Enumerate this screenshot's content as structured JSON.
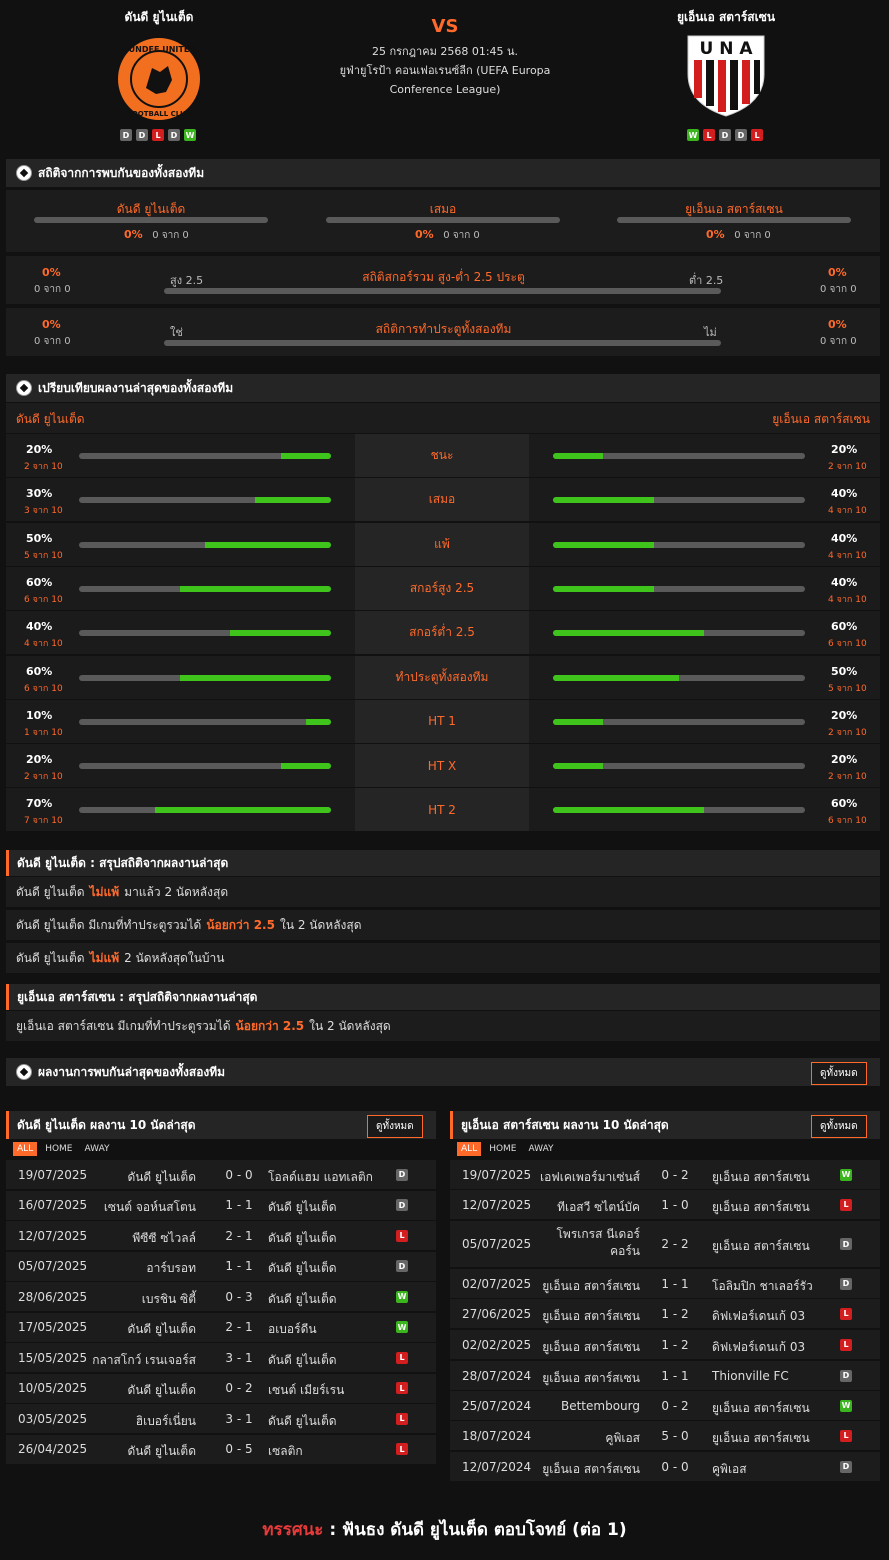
{
  "header": {
    "home_name": "ดันดี ยูไนเต็ด",
    "away_name": "ยูเอ็นเอ สตาร์สเซน",
    "vs": "VS",
    "date": "25 กรกฎาคม 2568 01:45 น.",
    "league_line1": "ยูฟ่ายูโรป้า คอนเฟอเรนซ์ลีก (UEFA Europa",
    "league_line2": "Conference League)",
    "home_logo_text": "DUNDEE UNITED FOOTBALL CLUB",
    "away_logo_text": "UNA",
    "home_form": [
      "D",
      "D",
      "L",
      "D",
      "W"
    ],
    "away_form": [
      "W",
      "L",
      "D",
      "D",
      "L"
    ]
  },
  "h2h": {
    "title": "สถิติจากการพบกันของทั้งสองทีม",
    "cols": [
      {
        "label": "ดันดี ยูไนเต็ด",
        "pct": "0%",
        "sub": "0 จาก 0"
      },
      {
        "label": "เสมอ",
        "pct": "0%",
        "sub": "0 จาก 0"
      },
      {
        "label": "ยูเอ็นเอ สตาร์สเซน",
        "pct": "0%",
        "sub": "0 จาก 0"
      }
    ],
    "ou": {
      "title": "สถิติสกอร์รวม สูง-ต่ำ 2.5 ประตู",
      "left_label": "สูง 2.5",
      "right_label": "ต่ำ 2.5",
      "left_pct": "0%",
      "left_sub": "0 จาก 0",
      "right_pct": "0%",
      "right_sub": "0 จาก 0"
    },
    "btts": {
      "title": "สถิติการทำประตูทั้งสองทีม",
      "left_label": "ใช่",
      "right_label": "ไม่",
      "left_pct": "0%",
      "left_sub": "0 จาก 0",
      "right_pct": "0%",
      "right_sub": "0 จาก 0"
    }
  },
  "compare": {
    "title": "เปรียบเทียบผลงานล่าสุดของทั้งสองทีม",
    "home_label": "ดันดี ยูไนเต็ด",
    "away_label": "ยูเอ็นเอ สตาร์สเซน",
    "rows": [
      {
        "label": "ชนะ",
        "hp": "20%",
        "hs": "2 จาก 10",
        "hv": 0.2,
        "ap": "20%",
        "as": "2 จาก 10",
        "av": 0.2
      },
      {
        "label": "เสมอ",
        "hp": "30%",
        "hs": "3 จาก 10",
        "hv": 0.3,
        "ap": "40%",
        "as": "4 จาก 10",
        "av": 0.4
      },
      {
        "label": "แพ้",
        "hp": "50%",
        "hs": "5 จาก 10",
        "hv": 0.5,
        "ap": "40%",
        "as": "4 จาก 10",
        "av": 0.4
      },
      {
        "label": "สกอร์สูง 2.5",
        "hp": "60%",
        "hs": "6 จาก 10",
        "hv": 0.6,
        "ap": "40%",
        "as": "4 จาก 10",
        "av": 0.4
      },
      {
        "label": "สกอร์ต่ำ 2.5",
        "hp": "40%",
        "hs": "4 จาก 10",
        "hv": 0.4,
        "ap": "60%",
        "as": "6 จาก 10",
        "av": 0.6
      },
      {
        "label": "ทำประตูทั้งสองทีม",
        "hp": "60%",
        "hs": "6 จาก 10",
        "hv": 0.6,
        "ap": "50%",
        "as": "5 จาก 10",
        "av": 0.5
      },
      {
        "label": "HT 1",
        "hp": "10%",
        "hs": "1 จาก 10",
        "hv": 0.1,
        "ap": "20%",
        "as": "2 จาก 10",
        "av": 0.2
      },
      {
        "label": "HT X",
        "hp": "20%",
        "hs": "2 จาก 10",
        "hv": 0.2,
        "ap": "20%",
        "as": "2 จาก 10",
        "av": 0.2
      },
      {
        "label": "HT 2",
        "hp": "70%",
        "hs": "7 จาก 10",
        "hv": 0.7,
        "ap": "60%",
        "as": "6 จาก 10",
        "av": 0.6
      }
    ]
  },
  "summary_home": {
    "title": "ดันดี ยูไนเต็ด : สรุปสถิติจากผลงานล่าสุด",
    "lines": [
      [
        "ดันดี ยูไนเต็ด",
        "ไม่แพ้",
        "มาแล้ว 2 นัดหลังสุด"
      ],
      [
        "ดันดี ยูไนเต็ด มีเกมที่ทำประตูรวมได้",
        "น้อยกว่า 2.5",
        "ใน 2 นัดหลังสุด"
      ],
      [
        "ดันดี ยูไนเต็ด",
        "ไม่แพ้",
        "2 นัดหลังสุดในบ้าน"
      ]
    ]
  },
  "summary_away": {
    "title": "ยูเอ็นเอ สตาร์สเซน : สรุปสถิติจากผลงานล่าสุด",
    "lines": [
      [
        "ยูเอ็นเอ สตาร์สเซน มีเกมที่ทำประตูรวมได้",
        "น้อยกว่า 2.5",
        "ใน 2 นัดหลังสุด"
      ]
    ]
  },
  "recent": {
    "title": "ผลงานการพบกันล่าสุดของทั้งสองทีม",
    "view_all": "ดูทั้งหมด"
  },
  "home_table": {
    "title": "ดันดี ยูไนเต็ด ผลงาน 10 นัดล่าสุด",
    "view_all": "ดูทั้งหมด",
    "tabs": [
      "ALL",
      "HOME",
      "AWAY"
    ],
    "rows": [
      {
        "date": "19/07/2025",
        "home": "ดันดี ยูไนเต็ด",
        "score": "0 - 0",
        "away": "โอลด์แฮม แอทเลติก",
        "res": "D"
      },
      {
        "date": "16/07/2025",
        "home": "เซนต์ จอห์นสโตน",
        "score": "1 - 1",
        "away": "ดันดี ยูไนเต็ด",
        "res": "D"
      },
      {
        "date": "12/07/2025",
        "home": "พีซีซี ซไวลล์",
        "score": "2 - 1",
        "away": "ดันดี ยูไนเต็ด",
        "res": "L"
      },
      {
        "date": "05/07/2025",
        "home": "อาร์บรอท",
        "score": "1 - 1",
        "away": "ดันดี ยูไนเต็ด",
        "res": "D"
      },
      {
        "date": "28/06/2025",
        "home": "เบรชิน ซิตี้",
        "score": "0 - 3",
        "away": "ดันดี ยูไนเต็ด",
        "res": "W"
      },
      {
        "date": "17/05/2025",
        "home": "ดันดี ยูไนเต็ด",
        "score": "2 - 1",
        "away": "อเบอร์ดีน",
        "res": "W"
      },
      {
        "date": "15/05/2025",
        "home": "กลาสโกว์ เรนเจอร์ส",
        "score": "3 - 1",
        "away": "ดันดี ยูไนเต็ด",
        "res": "L"
      },
      {
        "date": "10/05/2025",
        "home": "ดันดี ยูไนเต็ด",
        "score": "0 - 2",
        "away": "เซนต์ เมียร์เรน",
        "res": "L"
      },
      {
        "date": "03/05/2025",
        "home": "ฮิเบอร์เนี่ยน",
        "score": "3 - 1",
        "away": "ดันดี ยูไนเต็ด",
        "res": "L"
      },
      {
        "date": "26/04/2025",
        "home": "ดันดี ยูไนเต็ด",
        "score": "0 - 5",
        "away": "เซลติก",
        "res": "L"
      }
    ]
  },
  "away_table": {
    "title": "ยูเอ็นเอ สตาร์สเซน ผลงาน 10 นัดล่าสุด",
    "view_all": "ดูทั้งหมด",
    "tabs": [
      "ALL",
      "HOME",
      "AWAY"
    ],
    "rows": [
      {
        "date": "19/07/2025",
        "home": "เอฟเคเพอร์มาเซ่นส์",
        "home2": "",
        "score": "0 - 2",
        "away": "ยูเอ็นเอ สตาร์สเซน",
        "res": "W"
      },
      {
        "date": "12/07/2025",
        "home": "ทีเอสวี ซไตน์บัค",
        "home2": "",
        "score": "1 - 0",
        "away": "ยูเอ็นเอ สตาร์สเซน",
        "res": "L"
      },
      {
        "date": "05/07/2025",
        "home": "โพรเกรส นีเดอร์",
        "home2": "คอร์น",
        "score": "2 - 2",
        "away": "ยูเอ็นเอ สตาร์สเซน",
        "res": "D"
      },
      {
        "date": "02/07/2025",
        "home": "ยูเอ็นเอ สตาร์สเซน",
        "home2": "",
        "score": "1 - 1",
        "away": "โอลิมปิก ชาเลอร์รัว",
        "res": "D"
      },
      {
        "date": "27/06/2025",
        "home": "ยูเอ็นเอ สตาร์สเซน",
        "home2": "",
        "score": "1 - 2",
        "away": "ดิฟเฟอร์เดนเก้ 03",
        "res": "L"
      },
      {
        "date": "02/02/2025",
        "home": "ยูเอ็นเอ สตาร์สเซน",
        "home2": "",
        "score": "1 - 2",
        "away": "ดิฟเฟอร์เดนเก้ 03",
        "res": "L"
      },
      {
        "date": "28/07/2024",
        "home": "ยูเอ็นเอ สตาร์สเซน",
        "home2": "",
        "score": "1 - 1",
        "away": "Thionville FC",
        "res": "D"
      },
      {
        "date": "25/07/2024",
        "home": "Bettembourg",
        "home2": "",
        "score": "0 - 2",
        "away": "ยูเอ็นเอ สตาร์สเซน",
        "res": "W"
      },
      {
        "date": "18/07/2024",
        "home": "คูพิเอส",
        "home2": "",
        "score": "5 - 0",
        "away": "ยูเอ็นเอ สตาร์สเซน",
        "res": "L"
      },
      {
        "date": "12/07/2024",
        "home": "ยูเอ็นเอ สตาร์สเซน",
        "home2": "",
        "score": "0 - 0",
        "away": "คูพิเอส",
        "res": "D"
      }
    ]
  },
  "verdict": {
    "label": "ทรรศนะ",
    "colon": ":",
    "text": "ฟันธง ดันดี ยูไนเต็ด ตอบโจทย์ (ต่อ 1)"
  },
  "colors": {
    "accent": "#ff6a2b",
    "win": "#3ab51d",
    "loss": "#d21e1e",
    "draw": "#666666",
    "bar_fill": "#3ec41b"
  }
}
